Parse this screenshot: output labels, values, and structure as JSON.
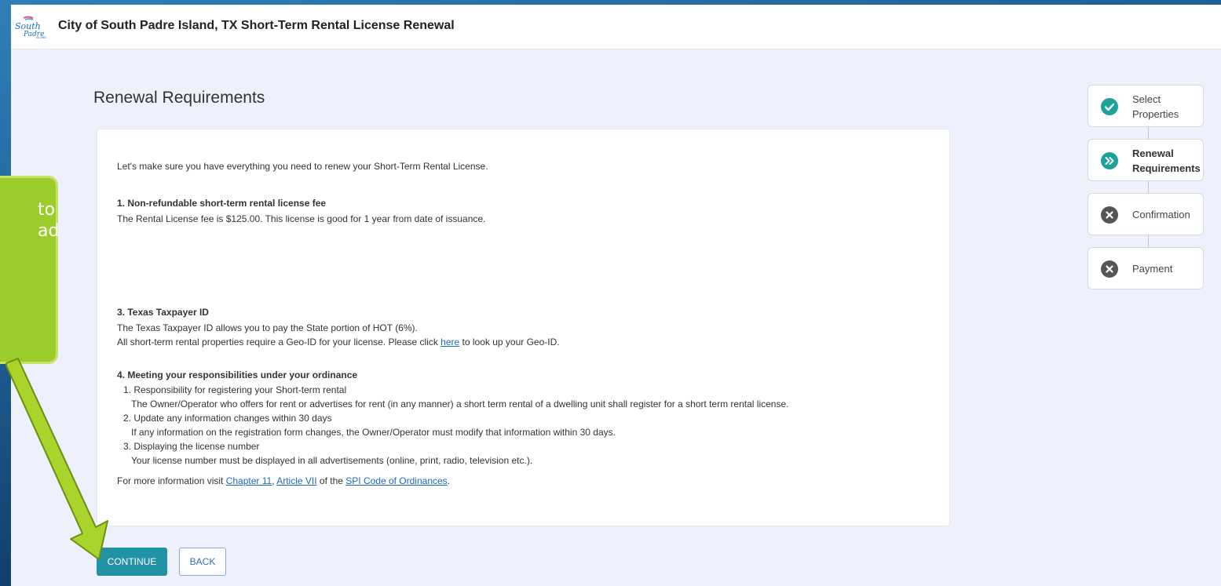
{
  "app": {
    "title": "City of South Padre Island, TX Short-Term Rental License Renewal",
    "logo_text": "South Padre Island"
  },
  "page": {
    "heading": "Renewal Requirements"
  },
  "content": {
    "intro": "Let's make sure you have everything you need to renew your Short-Term Rental License.",
    "section1_title": "1. Non-refundable short-term rental license fee",
    "section1_text": "The Rental License fee is $125.00. This license is good for 1 year from date of issuance.",
    "section3_title": "3. Texas Taxpayer ID",
    "section3_line1": "The Texas Taxpayer ID allows you to pay the State portion of HOT (6%).",
    "section3_line2_pre": "All short-term rental properties require a Geo-ID for your license. Please click ",
    "section3_link": "here",
    "section3_line2_post": " to look up your Geo-ID.",
    "section4_title": "4. Meeting your responsibilities under your ordinance",
    "items": [
      {
        "title": "1. Responsibility for registering your Short-term rental",
        "text": "The Owner/Operator who offers for rent or advertises for rent (in any manner) a short term rental of a dwelling unit shall register for a short term rental license."
      },
      {
        "title": "2. Update any information changes within 30 days",
        "text": "If any information on the registration form changes, the Owner/Operator must modify that information within 30 days."
      },
      {
        "title": "3. Displaying the license number",
        "text": "Your license number must be displayed in all advertisements (online, print, radio, television etc.)."
      }
    ],
    "more_info_pre": "For more information visit ",
    "link_chapter": "Chapter 11",
    "comma": ", ",
    "link_article": "Article VII",
    "of_the": " of the ",
    "link_code": "SPI Code of Ordinances",
    "period": "."
  },
  "buttons": {
    "continue": "CONTINUE",
    "back": "BACK"
  },
  "stepper": {
    "steps": [
      {
        "line1": "Select",
        "line2": "Properties",
        "status": "complete",
        "icon": "check-circle-icon"
      },
      {
        "line1": "Renewal",
        "line2": "Requirements",
        "status": "current",
        "icon": "double-chevron-circle-icon"
      },
      {
        "line1": "Confirmation",
        "line2": "",
        "status": "incomplete",
        "icon": "x-circle-icon"
      },
      {
        "line1": "Payment",
        "line2": "",
        "status": "incomplete",
        "icon": "x-circle-icon"
      }
    ]
  },
  "callout": {
    "text": "to\nad"
  },
  "colors": {
    "accent": "#2193a6",
    "link": "#1a67c9",
    "callout": "#9ccc2a",
    "step_complete": "#1aa39a",
    "step_incomplete": "#555555"
  }
}
